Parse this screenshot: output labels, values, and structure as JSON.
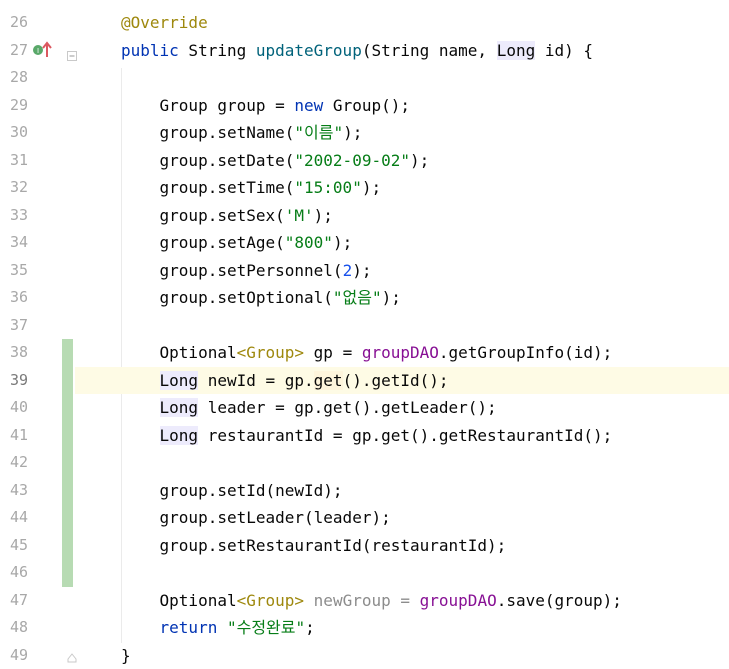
{
  "editor": {
    "lines": [
      {
        "n": "26",
        "tokens": [
          {
            "t": "@Override",
            "c": "t-ann"
          }
        ]
      },
      {
        "n": "27",
        "tokens": [
          {
            "t": "public",
            "c": "t-kw"
          },
          {
            "t": " String ",
            "c": "t-op"
          },
          {
            "t": "updateGroup",
            "c": "t-fn"
          },
          {
            "t": "(String name, ",
            "c": "t-op"
          },
          {
            "t": "Long",
            "c": "t-op hl"
          },
          {
            "t": " id) {",
            "c": "t-op"
          }
        ]
      },
      {
        "n": "28",
        "tokens": []
      },
      {
        "n": "29",
        "tokens": [
          {
            "t": "    Group group = ",
            "c": "t-op"
          },
          {
            "t": "new",
            "c": "t-kw"
          },
          {
            "t": " Group();",
            "c": "t-op"
          }
        ]
      },
      {
        "n": "30",
        "tokens": [
          {
            "t": "    group.setName(",
            "c": "t-op"
          },
          {
            "t": "\"이름\"",
            "c": "t-str"
          },
          {
            "t": ");",
            "c": "t-op"
          }
        ]
      },
      {
        "n": "31",
        "tokens": [
          {
            "t": "    group.setDate(",
            "c": "t-op"
          },
          {
            "t": "\"2002-09-02\"",
            "c": "t-str"
          },
          {
            "t": ");",
            "c": "t-op"
          }
        ]
      },
      {
        "n": "32",
        "tokens": [
          {
            "t": "    group.setTime(",
            "c": "t-op"
          },
          {
            "t": "\"15:00\"",
            "c": "t-str"
          },
          {
            "t": ");",
            "c": "t-op"
          }
        ]
      },
      {
        "n": "33",
        "tokens": [
          {
            "t": "    group.setSex(",
            "c": "t-op"
          },
          {
            "t": "'M'",
            "c": "t-str"
          },
          {
            "t": ");",
            "c": "t-op"
          }
        ]
      },
      {
        "n": "34",
        "tokens": [
          {
            "t": "    group.setAge(",
            "c": "t-op"
          },
          {
            "t": "\"800\"",
            "c": "t-str"
          },
          {
            "t": ");",
            "c": "t-op"
          }
        ]
      },
      {
        "n": "35",
        "tokens": [
          {
            "t": "    group.setPersonnel(",
            "c": "t-op"
          },
          {
            "t": "2",
            "c": "t-num"
          },
          {
            "t": ");",
            "c": "t-op"
          }
        ]
      },
      {
        "n": "36",
        "tokens": [
          {
            "t": "    group.setOptional(",
            "c": "t-op"
          },
          {
            "t": "\"없음\"",
            "c": "t-str"
          },
          {
            "t": ");",
            "c": "t-op"
          }
        ]
      },
      {
        "n": "37",
        "tokens": []
      },
      {
        "n": "38",
        "tokens": [
          {
            "t": "    Optional",
            "c": "t-op"
          },
          {
            "t": "<Group>",
            "c": "t-ann"
          },
          {
            "t": " gp = ",
            "c": "t-op"
          },
          {
            "t": "groupDAO",
            "c": "t-fld"
          },
          {
            "t": ".getGroupInfo(id);",
            "c": "t-op"
          }
        ]
      },
      {
        "n": "39",
        "tokens": [
          {
            "t": "    ",
            "c": "t-op"
          },
          {
            "t": "Long",
            "c": "t-op hl"
          },
          {
            "t": " newId = gp.",
            "c": "t-op"
          },
          {
            "t": "get",
            "c": "t-op hl2"
          },
          {
            "t": "().getId();",
            "c": "t-op"
          }
        ]
      },
      {
        "n": "40",
        "tokens": [
          {
            "t": "    ",
            "c": "t-op"
          },
          {
            "t": "Long",
            "c": "t-op hl"
          },
          {
            "t": " leader = gp.get().getLeader();",
            "c": "t-op"
          }
        ]
      },
      {
        "n": "41",
        "tokens": [
          {
            "t": "    ",
            "c": "t-op"
          },
          {
            "t": "Long",
            "c": "t-op hl"
          },
          {
            "t": " restaurantId = gp.get().getRestaurantId();",
            "c": "t-op"
          }
        ]
      },
      {
        "n": "42",
        "tokens": []
      },
      {
        "n": "43",
        "tokens": [
          {
            "t": "    group.setId(newId);",
            "c": "t-op"
          }
        ]
      },
      {
        "n": "44",
        "tokens": [
          {
            "t": "    group.setLeader(leader);",
            "c": "t-op"
          }
        ]
      },
      {
        "n": "45",
        "tokens": [
          {
            "t": "    group.setRestaurantId(restaurantId);",
            "c": "t-op"
          }
        ]
      },
      {
        "n": "46",
        "tokens": []
      },
      {
        "n": "47",
        "tokens": [
          {
            "t": "    Optional",
            "c": "t-op"
          },
          {
            "t": "<Group>",
            "c": "t-ann"
          },
          {
            "t": " ",
            "c": "t-op"
          },
          {
            "t": "newGroup",
            "c": "t-gray"
          },
          {
            "t": " = ",
            "c": "t-gray"
          },
          {
            "t": "groupDAO",
            "c": "t-fld"
          },
          {
            "t": ".save(group);",
            "c": "t-op"
          }
        ]
      },
      {
        "n": "48",
        "tokens": [
          {
            "t": "    ",
            "c": "t-op"
          },
          {
            "t": "return",
            "c": "t-kw"
          },
          {
            "t": " ",
            "c": "t-op"
          },
          {
            "t": "\"수정완료\"",
            "c": "t-str"
          },
          {
            "t": ";",
            "c": "t-op"
          }
        ]
      },
      {
        "n": "49",
        "tokens": [
          {
            "t": "}",
            "c": "t-op"
          }
        ]
      }
    ],
    "current_line": "39",
    "changed_lines": [
      "38",
      "39",
      "40",
      "41",
      "42",
      "43",
      "44",
      "45",
      "46"
    ],
    "gutter_icon": "implements-override-up-arrow-icon"
  }
}
